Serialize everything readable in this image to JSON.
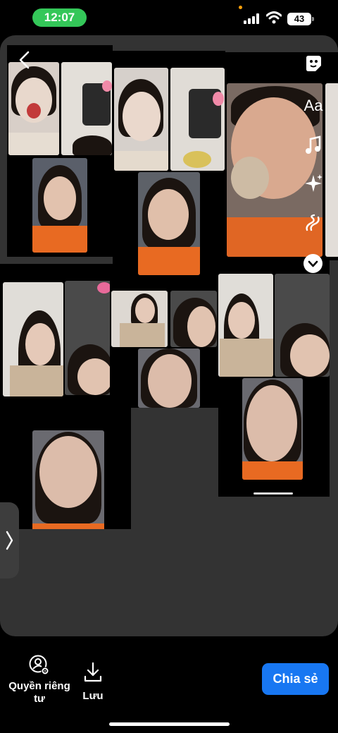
{
  "status_bar": {
    "time": "12:07",
    "battery": "43",
    "signal_icon": "cellular-signal-icon",
    "wifi_icon": "wifi-icon",
    "colors": {
      "time_pill": "#34c759",
      "privacy_dot": "#ff9f0a"
    }
  },
  "editor": {
    "back_icon": "chevron-left-icon",
    "tools": [
      {
        "name": "sticker-icon"
      },
      {
        "name": "text-tool",
        "label": "Aa"
      },
      {
        "name": "music-icon"
      },
      {
        "name": "effects-sparkle-icon"
      },
      {
        "name": "draw-squiggle-icon"
      },
      {
        "name": "more-chevron-down-icon"
      }
    ],
    "collage_panels": 6,
    "drawer_handle_icon": "chevron-right-icon"
  },
  "bottom_bar": {
    "privacy_label": "Quyền riêng tư",
    "privacy_icon": "person-gear-icon",
    "save_label": "Lưu",
    "save_icon": "download-icon",
    "share_label": "Chia sẻ",
    "colors": {
      "share": "#1877f2"
    }
  }
}
